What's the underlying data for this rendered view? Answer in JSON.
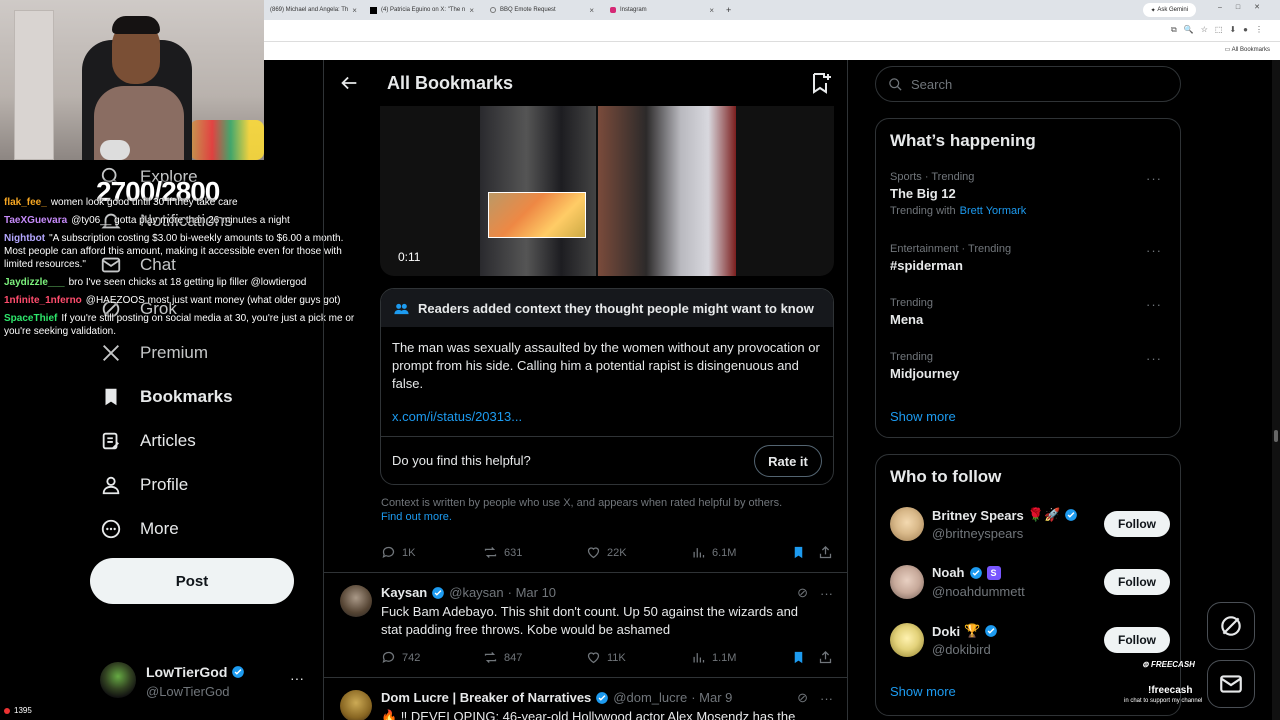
{
  "browser": {
    "tabs": [
      {
        "title": "(869) Michael and Angela: Th",
        "icon_color": "#e62117"
      },
      {
        "title": "(4) Patricia Eguino on X: \"The n",
        "icon_color": "#000000"
      },
      {
        "title": "BBQ Emote Request",
        "icon_color": "#777777"
      },
      {
        "title": "Instagram",
        "icon_color": "#d62976"
      }
    ],
    "new_tab": "+",
    "ask_gemini": "Ask Gemini",
    "all_bookmarks": "All Bookmarks"
  },
  "stream": {
    "sub_goal": "2700/2800",
    "viewer_count": "1395",
    "chat": [
      {
        "user": "flak_fee_",
        "color": "#f5a623",
        "text": "women look good until 30 if they take care"
      },
      {
        "user": "TaeXGuevara",
        "color": "#c58af9",
        "text": "@ty06__ gotta play more than 26 minutes a night"
      },
      {
        "user": "Nightbot",
        "color": "#b4a7ff",
        "text": "\"A subscription costing $3.00 bi-weekly amounts to $6.00 a month. Most people can afford this amount, making it accessible even for those with limited resources.\""
      },
      {
        "user": "Jaydizzle___",
        "color": "#7cf07c",
        "text": "bro I've seen chicks at 18 getting lip filler @lowtiergod"
      },
      {
        "user": "1nfinite_1nferno",
        "color": "#ff4d6d",
        "text": "@HAEZOOS most just want money (what older guys got)"
      },
      {
        "user": "SpaceThief",
        "color": "#2ee66b",
        "text": "If you're still posting on social media at 30, you're just a pick me or you're seeking validation."
      }
    ],
    "freecash_logo": "FREECASH",
    "freecash_cmd": "!freecash",
    "freecash_sub": "in chat to support my channel"
  },
  "nav": {
    "items": [
      {
        "label": "Explore",
        "icon": "search-icon"
      },
      {
        "label": "Notifications",
        "icon": "bell-icon"
      },
      {
        "label": "Chat",
        "icon": "mail-icon"
      },
      {
        "label": "Grok",
        "icon": "grok-icon"
      },
      {
        "label": "Premium",
        "icon": "x-logo-icon"
      },
      {
        "label": "Bookmarks",
        "icon": "bookmark-icon"
      },
      {
        "label": "Articles",
        "icon": "article-icon"
      },
      {
        "label": "Profile",
        "icon": "person-icon"
      },
      {
        "label": "More",
        "icon": "more-circle-icon"
      }
    ],
    "post_label": "Post",
    "account": {
      "name": "LowTierGod",
      "handle": "@LowTierGod",
      "more": "···"
    }
  },
  "main": {
    "title": "All Bookmarks",
    "video_time": "0:11",
    "community_note": {
      "header": "Readers added context they thought people might want to know",
      "body": "The man was sexually assaulted by the women without any provocation or prompt from his side. Calling him a potential rapist is disingenuous and false.",
      "link": "x.com/i/status/20313...",
      "question": "Do you find this helpful?",
      "rate_label": "Rate it"
    },
    "note_footer": "Context is written by people who use X, and appears when rated helpful by others.",
    "note_footer_link": "Find out more.",
    "tweet1_stats": {
      "replies": "1K",
      "reposts": "631",
      "likes": "22K",
      "views": "6.1M"
    },
    "tweet2": {
      "name": "Kaysan",
      "handle": "@kaysan",
      "date": "· Mar 10",
      "text": "Fuck Bam Adebayo. This shit don't count. Up 50 against the wizards and stat padding free throws. Kobe would be ashamed",
      "stats": {
        "replies": "742",
        "reposts": "847",
        "likes": "11K",
        "views": "1.1M"
      }
    },
    "tweet3": {
      "name": "Dom Lucre | Breaker of Narratives",
      "handle": "@dom_lucre",
      "date": "· Mar 9",
      "text": "DEVELOPING: 46-year-old Hollywood actor Alex Mosendz has the"
    }
  },
  "sidebar": {
    "search_placeholder": "Search",
    "happening_title": "What’s happening",
    "trends": [
      {
        "meta": "Sports · Trending",
        "name": "The Big 12",
        "with_prefix": "Trending with",
        "with_name": "Brett Yormark"
      },
      {
        "meta": "Entertainment · Trending",
        "name": "#spiderman"
      },
      {
        "meta": "Trending",
        "name": "Mena"
      },
      {
        "meta": "Trending",
        "name": "Midjourney"
      }
    ],
    "show_more": "Show more",
    "wtf_title": "Who to follow",
    "follow": [
      {
        "name": "Britney Spears",
        "extras": "🌹🚀",
        "handle": "@britneyspears",
        "avatar_color": "#d9b98a"
      },
      {
        "name": "Noah",
        "extras": "S",
        "handle": "@noahdummett",
        "avatar_color": "#c7a99a"
      },
      {
        "name": "Doki",
        "extras": "🏆",
        "handle": "@dokibird",
        "avatar_color": "#e3d27a"
      }
    ],
    "follow_label": "Follow",
    "show_more_2": "Show more"
  },
  "colors": {
    "accent": "#1d9bf0",
    "background": "#000000",
    "border": "#2f3336",
    "muted": "#71767b"
  }
}
